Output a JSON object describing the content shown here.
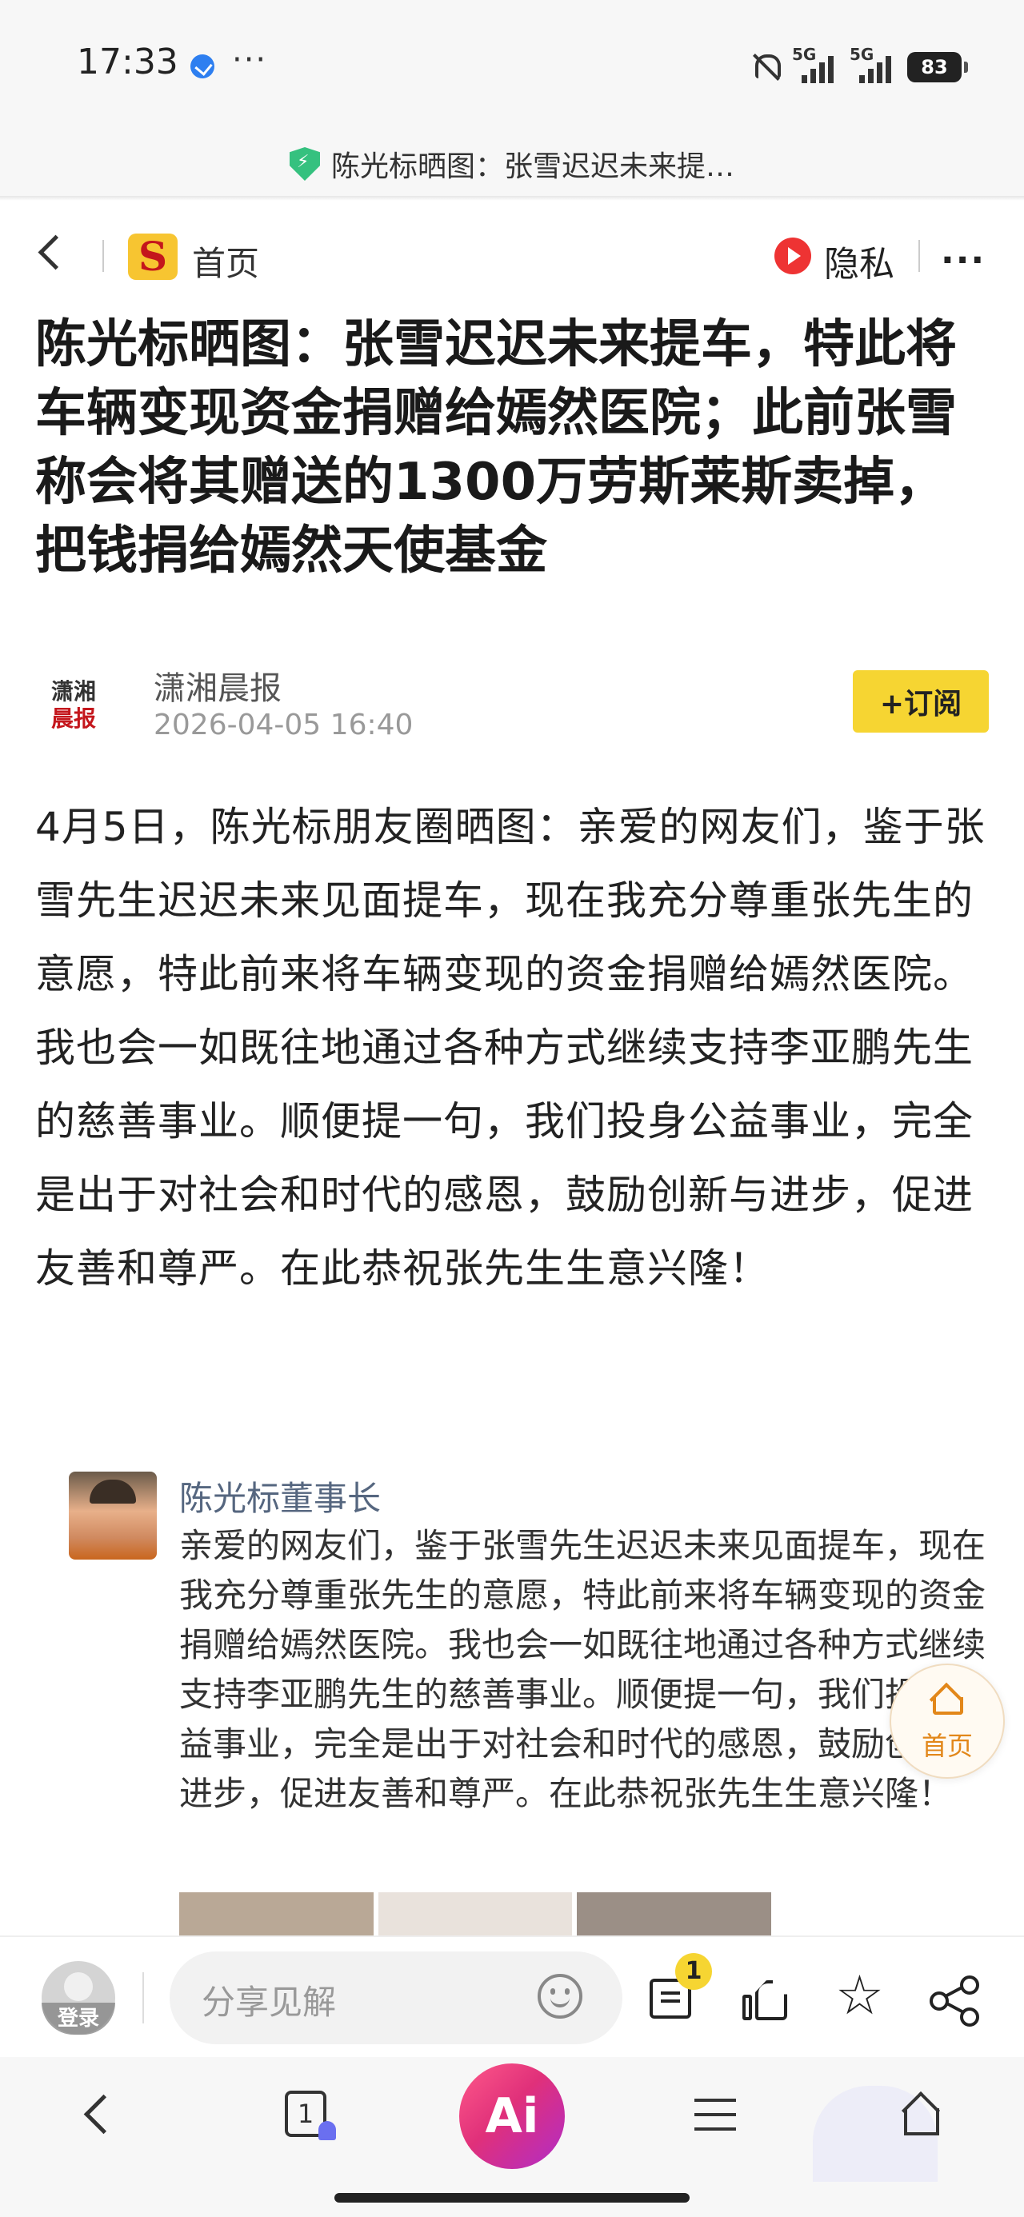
{
  "status_bar": {
    "time": "17:33",
    "more": "···",
    "signal1_label": "5G",
    "signal2_label": "5G",
    "battery": "83"
  },
  "url_bar": {
    "title": "陈光标晒图：张雪迟迟未来提…"
  },
  "nav": {
    "logo_glyph": "S",
    "home_label": "首页",
    "privacy_label": "隐私",
    "more": "···"
  },
  "article": {
    "headline": "陈光标晒图：张雪迟迟未来提车，特此将车辆变现资金捐赠给嫣然医院；此前张雪称会将其赠送的1300万劳斯莱斯卖掉，把钱捐给嫣然天使基金",
    "source": {
      "logo_line1": "潇湘",
      "logo_line2": "晨报",
      "name": "潇湘晨报",
      "date": "2026-04-05 16:40",
      "subscribe_label": "+订阅"
    },
    "body": "4月5日，陈光标朋友圈晒图：亲爱的网友们，鉴于张雪先生迟迟未来见面提车，现在我充分尊重张先生的意愿，特此前来将车辆变现的资金捐赠给嫣然医院。我也会一如既往地通过各种方式继续支持李亚鹏先生的慈善事业。顺便提一句，我们投身公益事业，完全是出于对社会和时代的感恩，鼓励创新与进步，促进友善和尊严。在此恭祝张先生生意兴隆！",
    "embed": {
      "name": "陈光标董事长",
      "text": "亲爱的网友们，鉴于张雪先生迟迟未来见面提车，现在我充分尊重张先生的意愿，特此前来将车辆变现的资金捐赠给嫣然医院。我也会一如既往地通过各种方式继续支持李亚鹏先生的慈善事业。顺便提一句，我们投身公益事业，完全是出于对社会和时代的感恩，鼓励创新与进步，促进友善和尊严。在此恭祝张先生生意兴隆！"
    }
  },
  "float_home": {
    "label": "首页"
  },
  "comment_bar": {
    "login_label": "登录",
    "placeholder": "分享见解",
    "comment_count": "1"
  },
  "browser_nav": {
    "tab_count": "1",
    "ai_label": "Ai"
  },
  "colors": {
    "accent_yellow": "#f6d532",
    "float_home_orange": "#e2871a",
    "ai_gradient_start": "#ff5a8a",
    "ai_gradient_end": "#b02cc9"
  }
}
